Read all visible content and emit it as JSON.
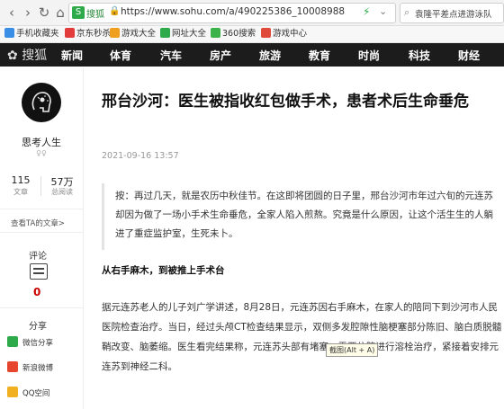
{
  "browser": {
    "tab_logo": "搜狐",
    "url": "https://www.sohu.com/a/490225386_100089882",
    "search_text": "袁隆平差点进游泳队"
  },
  "bookmarks": [
    {
      "label": "手机收藏夹",
      "color": "#3a8ee6"
    },
    {
      "label": "京东秒杀",
      "color": "#e23c3c"
    },
    {
      "label": "游戏大全",
      "color": "#f0a020"
    },
    {
      "label": "网址大全",
      "color": "#2eaa4a"
    },
    {
      "label": "360搜索",
      "color": "#3cb34a"
    },
    {
      "label": "游戏中心",
      "color": "#e04a3a"
    }
  ],
  "nav": {
    "logo": "搜狐",
    "items": [
      "新闻",
      "体育",
      "汽车",
      "房产",
      "旅游",
      "教育",
      "时尚",
      "科技",
      "财经"
    ]
  },
  "sidebar": {
    "author": "思考人生",
    "author_tags": "♀♀",
    "stats": [
      {
        "value": "115",
        "label": "文章"
      },
      {
        "value": "57万",
        "label": "总阅读"
      }
    ],
    "all_articles": "查看TA的文章>",
    "comment_label": "评论",
    "comment_count": "0",
    "share_label": "分享",
    "share_items": [
      {
        "label": "微信分享",
        "color": "#2eaa4a"
      },
      {
        "label": "新浪微博",
        "color": "#e6462d"
      },
      {
        "label": "QQ空间",
        "color": "#f0b020"
      }
    ]
  },
  "article": {
    "title": "邢台沙河：医生被指收红包做手术，患者术后生命垂危",
    "date": "2021-09-16 13:57",
    "intro": "按：再过几天，就是农历中秋佳节。在这即将团圆的日子里，邢台沙河市年过六旬的元连苏却因为做了一场小手术生命垂危，全家人陷入煎熬。究竟是什么原因，让这个活生生的人躺进了重症监护室，生死未卜。",
    "subhead": "从右手麻木，到被推上手术台",
    "para1": "据元连苏老人的儿子刘广学讲述，8月28日，元连苏因右手麻木，在家人的陪同下到沙河市人民医院检查治疗。当日，经过头颅CT检查结果显示，双侧多发腔隙性脑梗塞部分陈旧、脑白质脱髓鞘改变、脑萎缩。医生看完结果称，元连苏头部有堵塞，需要住院进行溶栓治疗，紧接着安排元连苏到神经二科。",
    "tooltip": "截图(Alt + A)"
  }
}
